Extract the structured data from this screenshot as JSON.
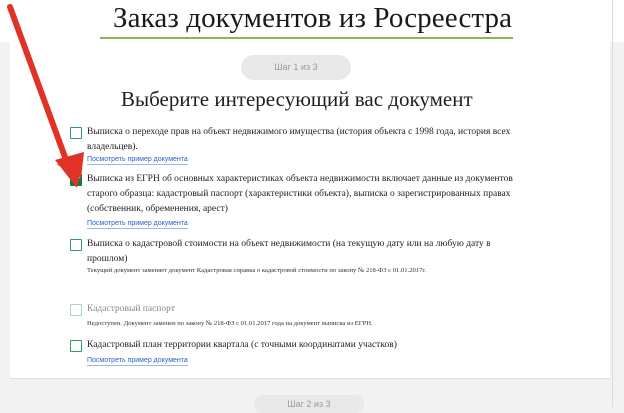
{
  "page_title": "Заказ документов из Росреестра",
  "steps": {
    "step1": "Шаг 1 из 3",
    "step2": "Шаг 2 из 3"
  },
  "section_heading": "Выберите интересующий вас документ",
  "sample_link_text": "Посмотреть пример документа",
  "options": [
    {
      "label": "Выписка о переходе прав на объект недвижимого имущества (история объекта с 1998 года, история всех владельцев).",
      "link": "Посмотреть пример документа",
      "checked": false
    },
    {
      "label": "Выписка из ЕГРН об основных характеристиках объекта недвижимости включает данные из документов старого образца: кадастровый паспорт (характеристики объекта), выписка о зарегистрированных правах (собственник, обременения, арест)",
      "link": "Посмотреть пример документа",
      "checked": true
    },
    {
      "label": "Выписка о кадастровой стоимости на объект недвижимости (на текущую дату или на любую дату в прошлом)",
      "note": "Текущий документ заменяет документ Кадастровая справка о кадастровой стоимости по закону № 218-ФЗ с 01.01.2017г.",
      "checked": false
    },
    {
      "label": "Кадастровый паспорт",
      "note": "Недоступен. Документ заменен по закону № 218-ФЗ с 01.01.2017 года на документ выписка из ЕГРН.",
      "checked": false,
      "disabled": true
    },
    {
      "label": "Кадастровый план территории квартала (с точными координатами участков)",
      "link": "Посмотреть пример документа",
      "checked": false
    }
  ],
  "colors": {
    "accent_green": "#157a43",
    "title_underline": "#8ab84a",
    "link_blue": "#2a62c9",
    "annotation_arrow": "#e03326"
  },
  "icons": {
    "annotation": "red-arrow-icon",
    "checkbox": "checkbox-icon"
  }
}
